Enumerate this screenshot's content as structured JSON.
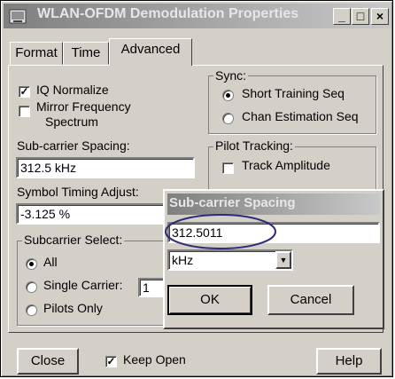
{
  "window": {
    "title": "WLAN-OFDM Demodulation Properties",
    "min_glyph": "_",
    "max_glyph": "□",
    "close_glyph": "×"
  },
  "tabs": [
    {
      "label": "Format"
    },
    {
      "label": "Time"
    },
    {
      "label": "Advanced"
    }
  ],
  "advanced": {
    "iq_normalize": {
      "label": "IQ Normalize",
      "checked": true,
      "mark": "✓"
    },
    "mirror_frequency": {
      "label_line1": "Mirror Frequency",
      "label_line2": "Spectrum",
      "checked": false
    },
    "subcarrier_spacing": {
      "label": "Sub-carrier Spacing:",
      "value": "312.5 kHz"
    },
    "symbol_timing": {
      "label": "Symbol Timing Adjust:",
      "value": "-3.125 %"
    },
    "subcarrier_select": {
      "legend": "Subcarrier Select:",
      "options": [
        {
          "label": "All",
          "selected": true
        },
        {
          "label": "Single Carrier:",
          "selected": false
        },
        {
          "label": "Pilots Only",
          "selected": false
        }
      ],
      "single_carrier_value": "1"
    },
    "sync": {
      "legend": "Sync:",
      "options": [
        {
          "label": "Short Training Seq",
          "selected": true
        },
        {
          "label": "Chan Estimation Seq",
          "selected": false
        }
      ]
    },
    "pilot_tracking": {
      "legend": "Pilot Tracking:",
      "track_amplitude": {
        "label": "Track Amplitude",
        "checked": false
      }
    }
  },
  "footer": {
    "close_label": "Close",
    "keep_open": {
      "label": "Keep Open",
      "checked": true,
      "mark": "✓"
    },
    "help_label": "Help"
  },
  "subdialog": {
    "title": "Sub-carrier Spacing",
    "value": "312.5011",
    "unit": "kHz",
    "dropdown_glyph": "▼",
    "ok_label": "OK",
    "cancel_label": "Cancel"
  },
  "colors": {
    "face": "#d4d0c8",
    "title_gradient_start": "#7f7f7f",
    "title_gradient_end": "#c8c8c8",
    "highlight_ellipse": "#2b2b7a"
  }
}
